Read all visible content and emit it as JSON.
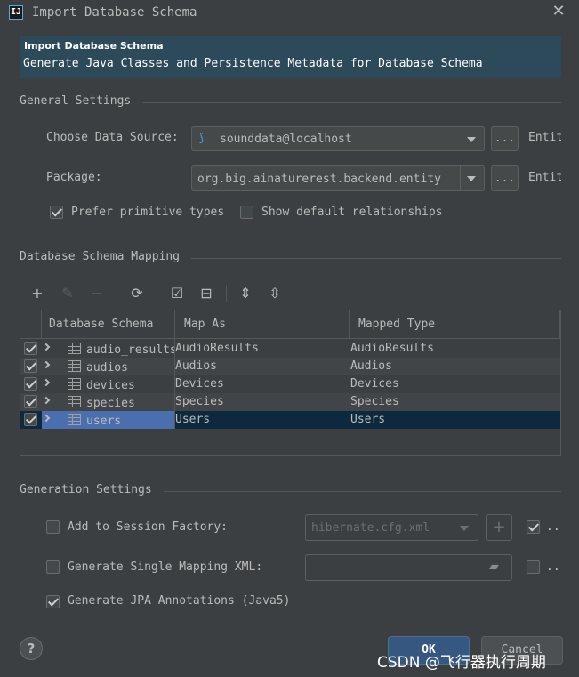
{
  "window": {
    "app_icon": "intellij-icon",
    "title": "Import Database Schema",
    "close_icon": "close-icon"
  },
  "banner": {
    "title": "Import Database Schema",
    "description": "Generate Java Classes and Persistence Metadata for Database Schema"
  },
  "general": {
    "heading": "General Settings",
    "data_source_label": "Choose Data Source:",
    "data_source_value": "sounddata@localhost",
    "data_source_icon": "datasource-icon",
    "package_label": "Package:",
    "package_value": "org.big.ainaturerest.backend.entity",
    "browse_label": "...",
    "entity_label_1": "Entit",
    "entity_label_2": "Entit",
    "prefer_primitive_label": "Prefer primitive types",
    "prefer_primitive_checked": true,
    "show_relationships_label": "Show default relationships",
    "show_relationships_checked": false
  },
  "mapping": {
    "heading": "Database Schema Mapping",
    "toolbar_icons": [
      "add-icon",
      "edit-icon",
      "remove-icon",
      "refresh-icon",
      "check-all-icon",
      "uncheck-all-icon",
      "expand-all-icon",
      "collapse-all-icon"
    ],
    "columns": [
      "Database Schema",
      "Map As",
      "Mapped Type"
    ],
    "rows": [
      {
        "name": "audio_results",
        "map_as": "AudioResults",
        "mapped_type": "AudioResults",
        "checked": true
      },
      {
        "name": "audios",
        "map_as": "Audios",
        "mapped_type": "Audios",
        "checked": true
      },
      {
        "name": "devices",
        "map_as": "Devices",
        "mapped_type": "Devices",
        "checked": true
      },
      {
        "name": "species",
        "map_as": "Species",
        "mapped_type": "Species",
        "checked": true
      },
      {
        "name": "users",
        "map_as": "Users",
        "mapped_type": "Users",
        "checked": true
      }
    ],
    "selected_row": "users"
  },
  "generation": {
    "heading": "Generation Settings",
    "session_factory_label": "Add to Session Factory:",
    "session_factory_checked": false,
    "session_factory_value": "hibernate.cfg.xml",
    "session_factory_extra_checked": true,
    "single_xml_label": "Generate Single Mapping XML:",
    "single_xml_checked": false,
    "single_xml_value": "",
    "single_xml_extra_checked": false,
    "jpa_label": "Generate JPA Annotations (Java5)",
    "jpa_checked": true,
    "ellipsis": ".."
  },
  "footer": {
    "help_label": "?",
    "ok_label": "OK",
    "cancel_label": "Cancel",
    "watermark": "CSDN @飞行器执行周期"
  },
  "colors": {
    "background": "#3c3f41",
    "banner": "#2c4a5a",
    "selection": "#4b6eaf",
    "ok_button": "#365880"
  }
}
